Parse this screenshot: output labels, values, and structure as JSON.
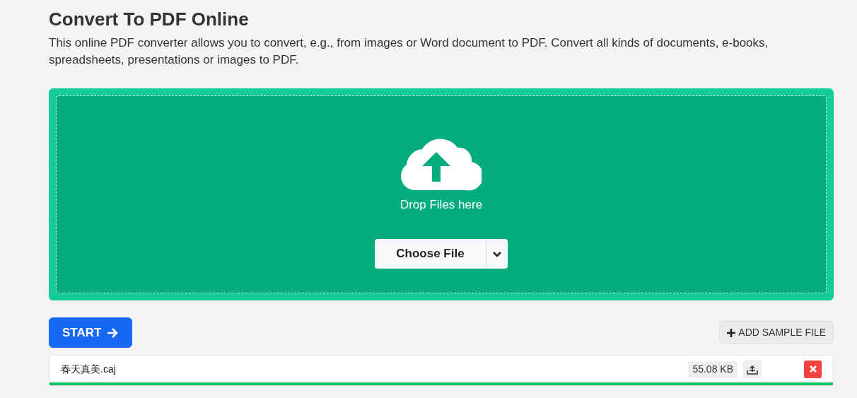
{
  "title": "Convert To PDF Online",
  "description": "This online PDF converter allows you to convert, e.g., from images or Word document to PDF. Convert all kinds of documents, e-books, spreadsheets, presentations or images to PDF.",
  "dropzone": {
    "label": "Drop Files here",
    "choose_button": "Choose File"
  },
  "start_button": "START",
  "sample_button": "ADD SAMPLE FILE",
  "files": [
    {
      "name": "春天真美.caj",
      "size": "55.08 KB",
      "level": 1
    }
  ]
}
